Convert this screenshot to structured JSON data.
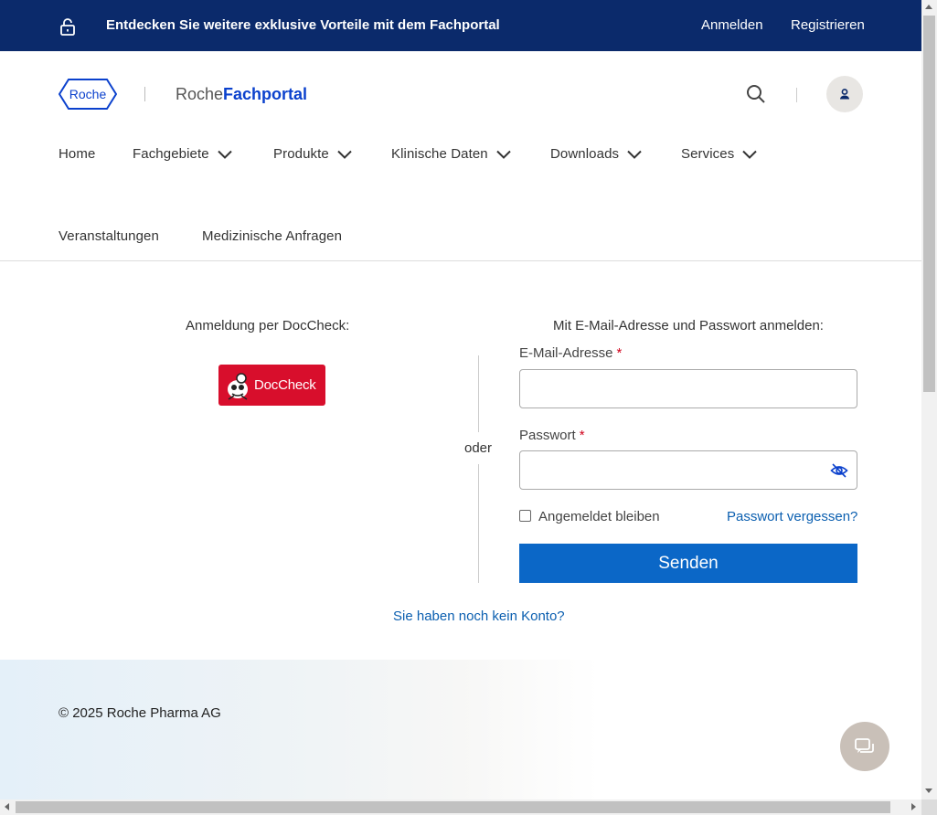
{
  "banner": {
    "promo": "Entdecken Sie weitere exklusive Vorteile mit dem Fachportal",
    "login": "Anmelden",
    "register": "Registrieren",
    "icon": "unlock-icon"
  },
  "header": {
    "logo_text": "Roche",
    "portal_prefix": "Roche",
    "portal_name": "Fachportal",
    "search_icon": "search-icon",
    "user_icon": "user-icon"
  },
  "nav": {
    "items": [
      {
        "label": "Home"
      },
      {
        "label": "Fachgebiete"
      },
      {
        "label": "Produkte"
      },
      {
        "label": "Klinische Daten"
      },
      {
        "label": "Downloads"
      },
      {
        "label": "Services"
      },
      {
        "label": "Veranstaltungen"
      },
      {
        "label": "Medizinische Anfragen"
      }
    ]
  },
  "login": {
    "doccheck_title": "Anmeldung per DocCheck:",
    "doccheck_button": "DocCheck",
    "separator": "oder",
    "mail_title": "Mit E-Mail-Adresse und Passwort anmelden:",
    "email_label": "E-Mail-Adresse",
    "email_value": "",
    "password_label": "Passwort",
    "password_value": "",
    "required_mark": "*",
    "remember_label": "Angemeldet bleiben",
    "remember_checked": false,
    "forgot_link": "Passwort vergessen?",
    "submit": "Senden",
    "no_account": "Sie haben noch kein Konto?"
  },
  "footer": {
    "copyright": "© 2025 Roche Pharma AG",
    "chat_icon": "chat-icon"
  },
  "colors": {
    "banner_bg": "#0b2a6b",
    "brand_blue": "#0b41cd",
    "button_blue": "#0b67c7",
    "link_blue": "#0b5fb0",
    "doccheck_red": "#d80e2c",
    "required_red": "#d0021b"
  }
}
